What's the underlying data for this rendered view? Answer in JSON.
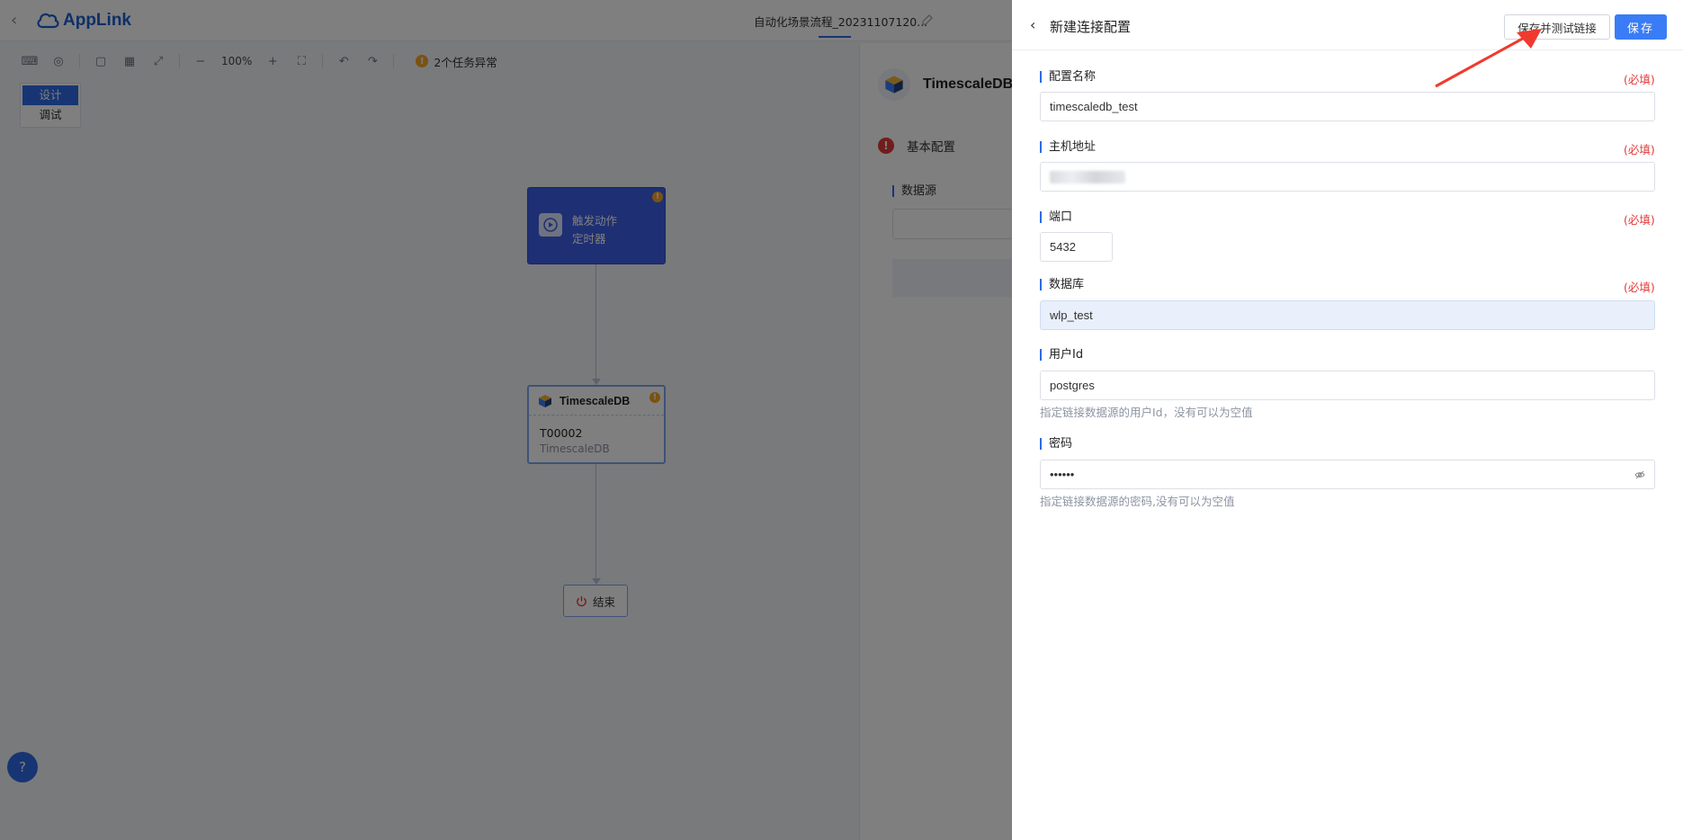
{
  "app": {
    "logo": "AppLink",
    "flow_title": "自动化场景流程_20231107120...",
    "toolbar": {
      "zoom": "100%",
      "warning": "2个任务异常"
    },
    "mode_switch": [
      "设计",
      "调试"
    ],
    "nodes": {
      "trigger": {
        "title": "触发动作",
        "subtitle": "定时器"
      },
      "db": {
        "title": "TimescaleDB",
        "code": "T00002",
        "subtitle": "TimescaleDB"
      },
      "end": {
        "label": "结束"
      }
    },
    "side_panel": {
      "title": "TimescaleDB",
      "section": "基本配置",
      "field_label": "数据源"
    }
  },
  "drawer": {
    "title": "新建连接配置",
    "buttons": {
      "save_and_test": "保存并测试链接",
      "save": "保存"
    },
    "required_text": "(必填)",
    "fields": {
      "config_name": {
        "label": "配置名称",
        "value": "timescaledb_test"
      },
      "host": {
        "label": "主机地址"
      },
      "port": {
        "label": "端口",
        "value": "5432"
      },
      "database": {
        "label": "数据库",
        "value": "wlp_test"
      },
      "user_id": {
        "label": "用户Id",
        "value": "postgres",
        "hint": "指定链接数据源的用户Id，没有可以为空值"
      },
      "password": {
        "label": "密码",
        "value": "••••••",
        "hint": "指定链接数据源的密码,没有可以为空值"
      }
    }
  },
  "colors": {
    "accent": "#3a7cf5",
    "required": "#e23b3b",
    "trigger_node": "#3f5fe6",
    "annotation_arrow": "#f03a2e"
  }
}
